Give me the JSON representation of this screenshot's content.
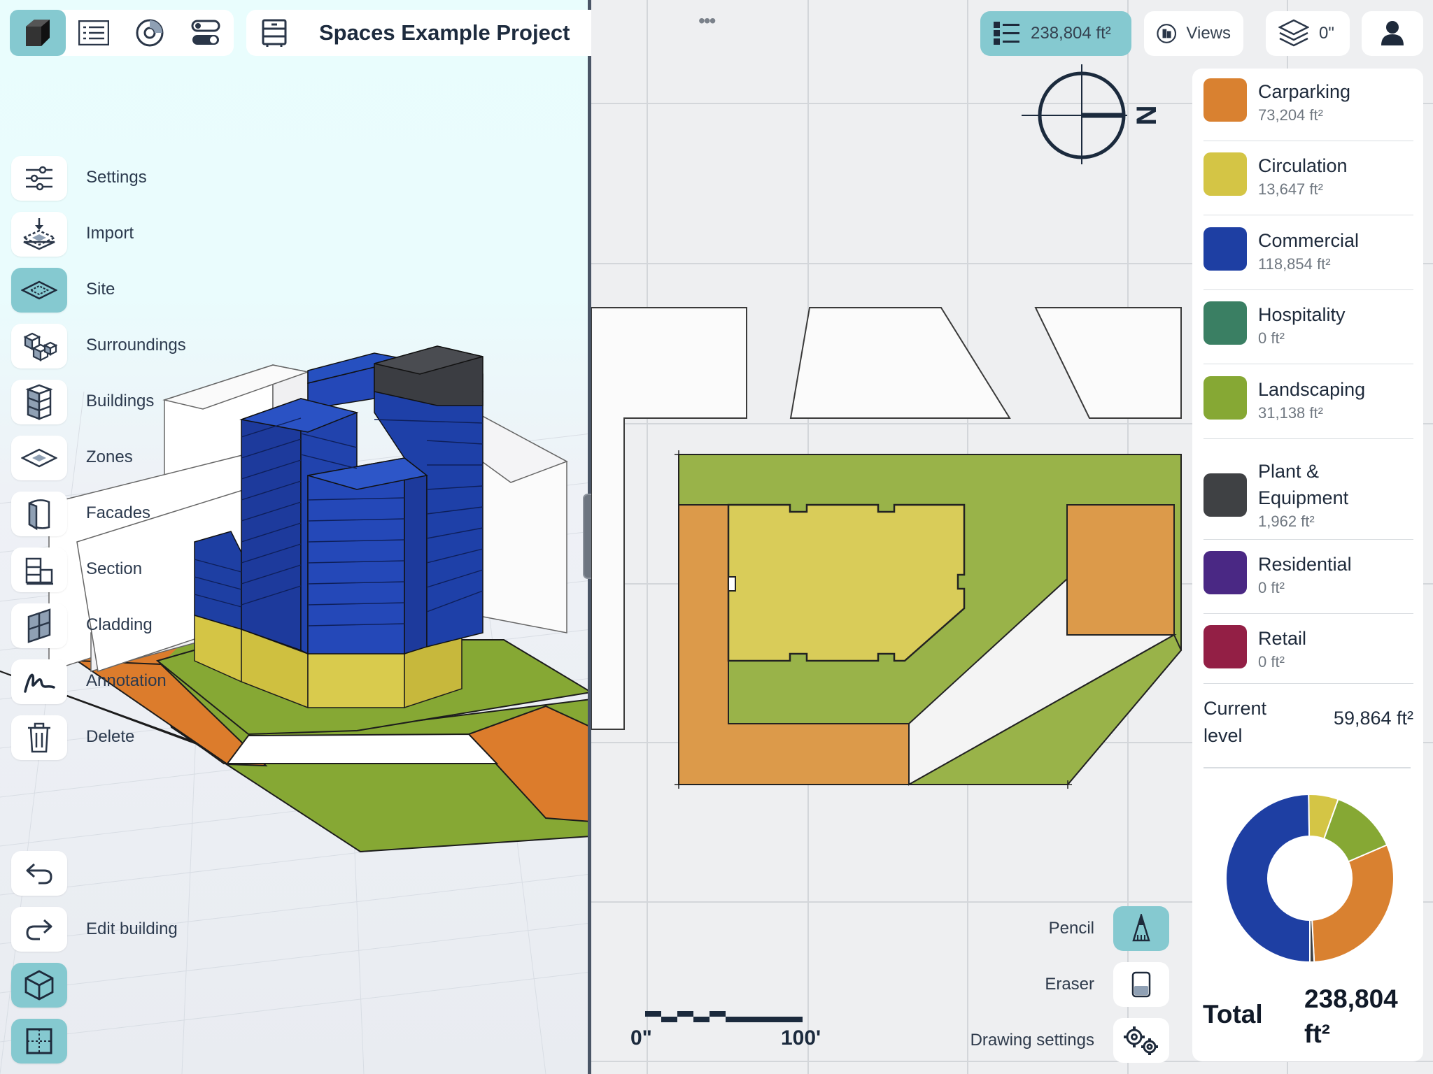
{
  "project": {
    "title": "Spaces Example Project"
  },
  "top_toolbar": {
    "icons": [
      "view-3d-icon",
      "list-icon",
      "chart-icon",
      "toggle-icon",
      "cabinet-icon",
      "settings-gear-icon"
    ]
  },
  "sidebar": {
    "items": [
      {
        "label": "Settings",
        "icon": "sliders-icon",
        "active": false
      },
      {
        "label": "Import",
        "icon": "import-icon",
        "active": false
      },
      {
        "label": "Site",
        "icon": "site-icon",
        "active": true
      },
      {
        "label": "Surroundings",
        "icon": "surroundings-icon",
        "active": false
      },
      {
        "label": "Buildings",
        "icon": "buildings-icon",
        "active": false
      },
      {
        "label": "Zones",
        "icon": "zones-icon",
        "active": false
      },
      {
        "label": "Facades",
        "icon": "facades-icon",
        "active": false
      },
      {
        "label": "Section",
        "icon": "section-icon",
        "active": false
      },
      {
        "label": "Cladding",
        "icon": "cladding-icon",
        "active": false
      },
      {
        "label": "Annotation",
        "icon": "annotation-icon",
        "active": false
      },
      {
        "label": "Delete",
        "icon": "trash-icon",
        "active": false
      }
    ],
    "bottom": {
      "undo_icon": "undo-icon",
      "redo_icon": "redo-icon",
      "edit_building_label": "Edit building",
      "cube_icon": "cube-icon",
      "plan_icon": "floorplan-icon"
    }
  },
  "header_right": {
    "area_total": "238,804 ft²",
    "views_label": "Views",
    "level_label": "0\"",
    "user_icon": "user-icon"
  },
  "compass": {
    "label": "N"
  },
  "legend": {
    "items": [
      {
        "name": "Carparking",
        "value": "73,204 ft²",
        "color": "#d98130"
      },
      {
        "name": "Circulation",
        "value": "13,647 ft²",
        "color": "#d4c545"
      },
      {
        "name": "Commercial",
        "value": "118,854 ft²",
        "color": "#1e3fa3"
      },
      {
        "name": "Hospitality",
        "value": "0 ft²",
        "color": "#3a7f63"
      },
      {
        "name": "Landscaping",
        "value": "31,138 ft²",
        "color": "#86a834"
      },
      {
        "name": "Plant & Equipment",
        "value": "1,962 ft²",
        "color": "#3f4144"
      },
      {
        "name": "Residential",
        "value": "0 ft²",
        "color": "#4a2884"
      },
      {
        "name": "Retail",
        "value": "0 ft²",
        "color": "#931f45"
      }
    ],
    "current_level_label": "Current level",
    "current_level_value": "59,864 ft²",
    "total_label": "Total",
    "total_value": "238,804 ft²"
  },
  "area_breakdown": {
    "values": [
      118854,
      13647,
      31138,
      73204,
      1962
    ]
  },
  "drawing_tools": {
    "pencil_label": "Pencil",
    "eraser_label": "Eraser",
    "settings_label": "Drawing settings"
  },
  "scale_bar": {
    "start": "0\"",
    "end": "100'"
  }
}
